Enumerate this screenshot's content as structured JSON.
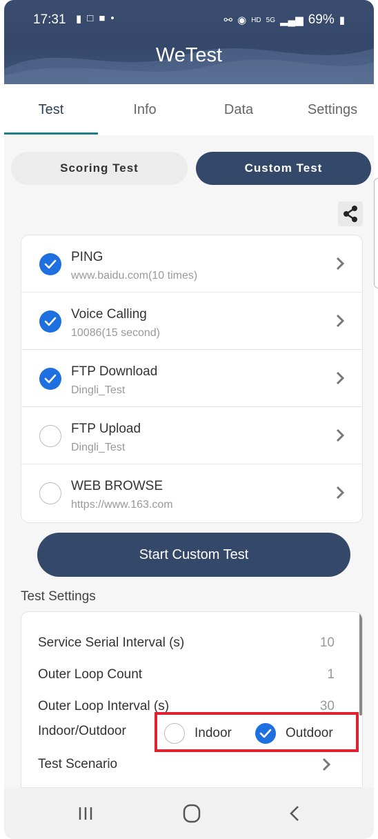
{
  "status_bar": {
    "time": "17:31",
    "network": "HD",
    "network_type": "5G",
    "battery": "69%",
    "icons_left": [
      "message-icon",
      "screenshot-icon",
      "cat-icon",
      "dot-icon"
    ],
    "icons_right": [
      "key-icon",
      "location-icon",
      "signal-icon",
      "battery-icon"
    ]
  },
  "app": {
    "title": "WeTest"
  },
  "tabs": [
    {
      "label": "Test",
      "active": true
    },
    {
      "label": "Info",
      "active": false
    },
    {
      "label": "Data",
      "active": false
    },
    {
      "label": "Settings",
      "active": false
    }
  ],
  "mode_toggle": {
    "scoring_label": "Scoring Test",
    "custom_label": "Custom Test",
    "selected": "Custom Test"
  },
  "share": {
    "icon": "share-icon"
  },
  "tests": [
    {
      "name": "PING",
      "detail": "www.baidu.com(10 times)",
      "checked": true
    },
    {
      "name": "Voice Calling",
      "detail": "10086(15 second)",
      "checked": true
    },
    {
      "name": "FTP Download",
      "detail": "Dingli_Test",
      "checked": true
    },
    {
      "name": "FTP Upload",
      "detail": "Dingli_Test",
      "checked": false
    },
    {
      "name": "WEB BROWSE",
      "detail": "https://www.163.com",
      "checked": false
    }
  ],
  "start_button": {
    "label": "Start Custom Test"
  },
  "settings": {
    "title": "Test Settings",
    "rows": [
      {
        "label": "Service Serial Interval (s)",
        "value": "10"
      },
      {
        "label": "Outer Loop Count",
        "value": "1"
      },
      {
        "label": "Outer Loop Interval (s)",
        "value": "30"
      }
    ],
    "indoor_outdoor": {
      "label": "Indoor/Outdoor",
      "indoor": "Indoor",
      "outdoor": "Outdoor",
      "selected": "Outdoor"
    },
    "scenario": {
      "label": "Test Scenario"
    }
  },
  "colors": {
    "primary": "#344869",
    "accent": "#1e6fe0",
    "highlight": "#e0222e",
    "tab_indicator": "#1b7e86"
  }
}
